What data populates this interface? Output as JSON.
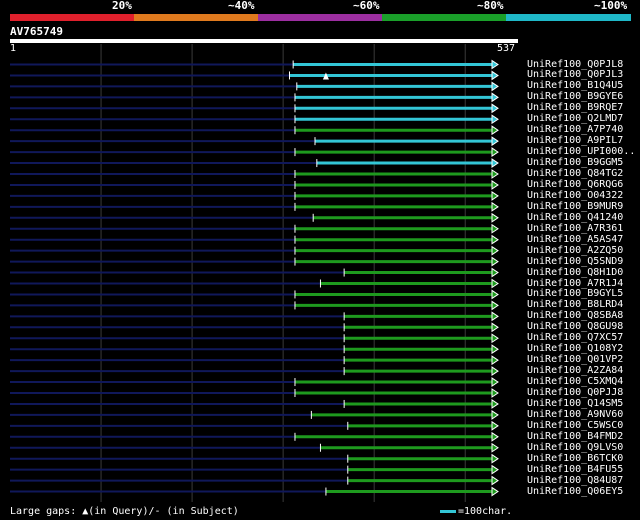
{
  "legend": {
    "segments": [
      {
        "label": "20%",
        "color": "#e0202c"
      },
      {
        "label": "~40%",
        "color": "#e07a1e"
      },
      {
        "label": "~60%",
        "color": "#9c2ea0"
      },
      {
        "label": "~80%",
        "color": "#1aa02a"
      },
      {
        "label": "~100%",
        "color": "#1fb8c8"
      }
    ]
  },
  "query": {
    "id": "AV765749",
    "start": "1",
    "end": "537",
    "length": 537
  },
  "colors": {
    "identity_100": "#33c6d6",
    "identity_80": "#1e9a1e",
    "background_line": "#10185a",
    "grid": "#3a3a3a",
    "arrow": "#ffffff"
  },
  "hits": [
    {
      "name": "UniRef100_Q0PJL8",
      "start": 312,
      "end": 537,
      "color": "cyan"
    },
    {
      "name": "UniRef100_Q0PJL3",
      "start": 308,
      "end": 537,
      "color": "cyan",
      "gap_query": 348
    },
    {
      "name": "UniRef100_B1Q4U5",
      "start": 316,
      "end": 537,
      "color": "cyan"
    },
    {
      "name": "UniRef100_B9GYE6",
      "start": 314,
      "end": 537,
      "color": "cyan"
    },
    {
      "name": "UniRef100_B9RQE7",
      "start": 314,
      "end": 537,
      "color": "cyan"
    },
    {
      "name": "UniRef100_Q2LMD7",
      "start": 314,
      "end": 537,
      "color": "cyan"
    },
    {
      "name": "UniRef100_A7P740",
      "start": 314,
      "end": 537,
      "color": "green"
    },
    {
      "name": "UniRef100_A9PIL7",
      "start": 336,
      "end": 537,
      "color": "cyan"
    },
    {
      "name": "UniRef100_UPI000..",
      "start": 314,
      "end": 537,
      "color": "green"
    },
    {
      "name": "UniRef100_B9GGM5",
      "start": 338,
      "end": 537,
      "color": "cyan"
    },
    {
      "name": "UniRef100_Q84TG2",
      "start": 314,
      "end": 537,
      "color": "green"
    },
    {
      "name": "UniRef100_Q6RQG6",
      "start": 314,
      "end": 537,
      "color": "green"
    },
    {
      "name": "UniRef100_O04322",
      "start": 314,
      "end": 537,
      "color": "green"
    },
    {
      "name": "UniRef100_B9MUR9",
      "start": 314,
      "end": 537,
      "color": "green"
    },
    {
      "name": "UniRef100_Q41240",
      "start": 334,
      "end": 537,
      "color": "green"
    },
    {
      "name": "UniRef100_A7R361",
      "start": 314,
      "end": 537,
      "color": "green"
    },
    {
      "name": "UniRef100_A5AS47",
      "start": 314,
      "end": 537,
      "color": "green"
    },
    {
      "name": "UniRef100_A2ZQ50",
      "start": 314,
      "end": 537,
      "color": "green"
    },
    {
      "name": "UniRef100_Q5SND9",
      "start": 314,
      "end": 537,
      "color": "green"
    },
    {
      "name": "UniRef100_Q8H1D0",
      "start": 368,
      "end": 537,
      "color": "green"
    },
    {
      "name": "UniRef100_A7R1J4",
      "start": 342,
      "end": 537,
      "color": "green"
    },
    {
      "name": "UniRef100_B9GYL5",
      "start": 314,
      "end": 537,
      "color": "green"
    },
    {
      "name": "UniRef100_B8LRD4",
      "start": 314,
      "end": 537,
      "color": "green"
    },
    {
      "name": "UniRef100_Q8SBA8",
      "start": 368,
      "end": 537,
      "color": "green"
    },
    {
      "name": "UniRef100_Q8GU98",
      "start": 368,
      "end": 537,
      "color": "green"
    },
    {
      "name": "UniRef100_Q7XC57",
      "start": 368,
      "end": 537,
      "color": "green"
    },
    {
      "name": "UniRef100_Q108Y2",
      "start": 368,
      "end": 537,
      "color": "green"
    },
    {
      "name": "UniRef100_Q01VP2",
      "start": 368,
      "end": 537,
      "color": "green"
    },
    {
      "name": "UniRef100_A2ZA84",
      "start": 368,
      "end": 537,
      "color": "green"
    },
    {
      "name": "UniRef100_C5XMQ4",
      "start": 314,
      "end": 537,
      "color": "green"
    },
    {
      "name": "UniRef100_Q0PJJ8",
      "start": 314,
      "end": 537,
      "color": "green"
    },
    {
      "name": "UniRef100_Q14SM5",
      "start": 368,
      "end": 537,
      "color": "green"
    },
    {
      "name": "UniRef100_A9NV60",
      "start": 332,
      "end": 537,
      "color": "green"
    },
    {
      "name": "UniRef100_C5WSC0",
      "start": 372,
      "end": 537,
      "color": "green"
    },
    {
      "name": "UniRef100_B4FMD2",
      "start": 314,
      "end": 537,
      "color": "green"
    },
    {
      "name": "UniRef100_Q9LVS0",
      "start": 342,
      "end": 537,
      "color": "green"
    },
    {
      "name": "UniRef100_B6TCK0",
      "start": 372,
      "end": 537,
      "color": "green"
    },
    {
      "name": "UniRef100_B4FU55",
      "start": 372,
      "end": 537,
      "color": "green"
    },
    {
      "name": "UniRef100_Q84U87",
      "start": 372,
      "end": 537,
      "color": "green"
    },
    {
      "name": "UniRef100_Q06EY5",
      "start": 348,
      "end": 537,
      "color": "green"
    }
  ],
  "footer": {
    "text": "Large gaps: ▲(in Query)/- (in Subject)"
  },
  "scale": {
    "text": "=100char."
  }
}
